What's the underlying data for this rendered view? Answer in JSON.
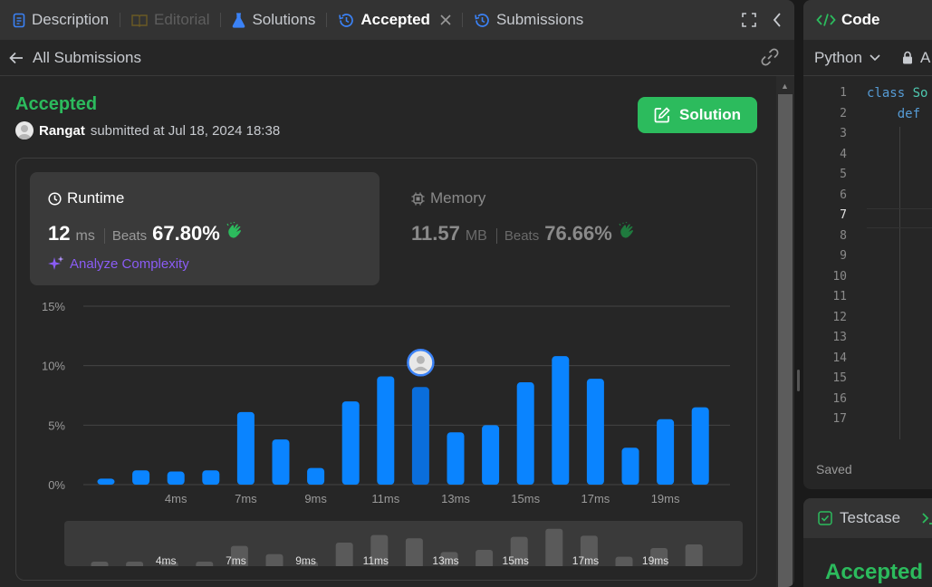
{
  "tabs": {
    "description": "Description",
    "editorial": "Editorial",
    "solutions": "Solutions",
    "accepted": "Accepted",
    "submissions": "Submissions"
  },
  "subheader": {
    "back_label": "All Submissions"
  },
  "submission": {
    "status": "Accepted",
    "user": "Rangat",
    "submitted_text": "submitted at Jul 18, 2024 18:38",
    "solution_button": "Solution"
  },
  "runtime": {
    "label": "Runtime",
    "value": "12",
    "unit": "ms",
    "beats_label": "Beats",
    "beats_value": "67.80%",
    "analyze_label": "Analyze Complexity"
  },
  "memory": {
    "label": "Memory",
    "value": "11.57",
    "unit": "MB",
    "beats_label": "Beats",
    "beats_value": "76.66%"
  },
  "colors": {
    "accent_green": "#2cbb5d",
    "bar_blue": "#0a84ff",
    "analyze_purple": "#8a5cf5"
  },
  "chart_data": {
    "type": "bar",
    "categories": [
      "",
      "",
      "4ms",
      "",
      "7ms",
      "",
      "9ms",
      "",
      "11ms",
      "",
      "13ms",
      "",
      "15ms",
      "",
      "17ms",
      "",
      "19ms",
      ""
    ],
    "values": [
      0.5,
      1.2,
      1.1,
      1.2,
      6.1,
      3.8,
      1.4,
      7.0,
      9.1,
      8.2,
      4.4,
      5.0,
      8.6,
      10.8,
      8.9,
      3.1,
      5.5,
      6.5
    ],
    "highlight_index": 9,
    "yticks": [
      "0%",
      "5%",
      "10%",
      "15%"
    ],
    "ylim": [
      0,
      15
    ],
    "grid": true,
    "xlabel": "",
    "ylabel": ""
  },
  "mini_chart": {
    "labels": [
      "4ms",
      "7ms",
      "9ms",
      "11ms",
      "13ms",
      "15ms",
      "17ms",
      "19ms"
    ]
  },
  "code_panel": {
    "title": "Code",
    "language": "Python",
    "lock_label": "A",
    "line_numbers": [
      "1",
      "2",
      "3",
      "4",
      "5",
      "6",
      "7",
      "8",
      "9",
      "10",
      "11",
      "12",
      "13",
      "14",
      "15",
      "16",
      "17"
    ],
    "current_line": "7",
    "line1_kw": "class",
    "line1_name": "So",
    "line2_kw": "def",
    "saved": "Saved"
  },
  "test_panel": {
    "label": "Testcase",
    "result": "Accepted"
  }
}
